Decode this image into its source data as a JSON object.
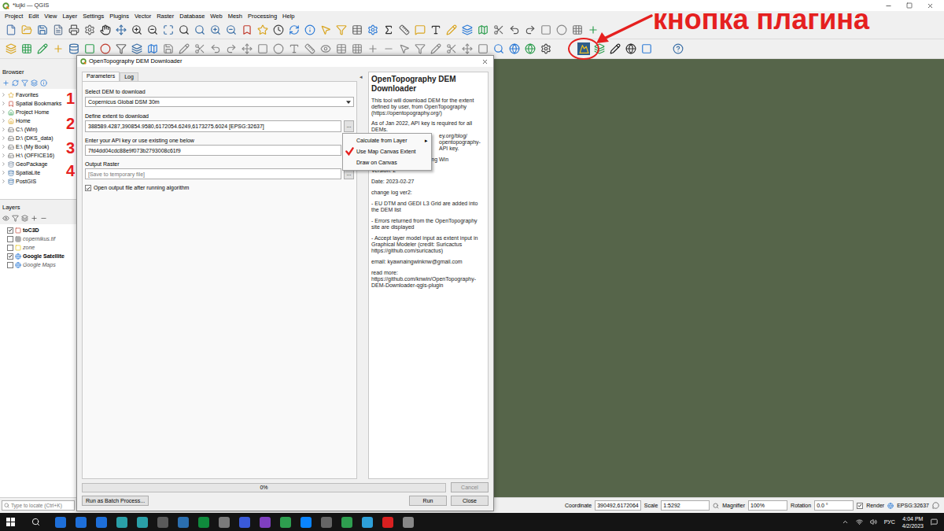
{
  "window": {
    "title": "*lujki — QGIS"
  },
  "menu": [
    "Project",
    "Edit",
    "View",
    "Layer",
    "Settings",
    "Plugins",
    "Vector",
    "Raster",
    "Database",
    "Web",
    "Mesh",
    "Processing",
    "Help"
  ],
  "annotation": {
    "label": "кнопка плагина",
    "steps": [
      "1",
      "2",
      "3",
      "4"
    ]
  },
  "browser": {
    "title": "Browser",
    "items": [
      {
        "label": "Favorites"
      },
      {
        "label": "Spatial Bookmarks"
      },
      {
        "label": "Project Home"
      },
      {
        "label": "Home"
      },
      {
        "label": "C:\\ (Win)"
      },
      {
        "label": "D:\\ (DKS_data)"
      },
      {
        "label": "E:\\ (My Book)"
      },
      {
        "label": "H:\\ (OFFICE16)"
      },
      {
        "label": "GeoPackage"
      },
      {
        "label": "SpatiaLite"
      },
      {
        "label": "PostGIS"
      }
    ]
  },
  "layers": {
    "title": "Layers",
    "items": [
      {
        "label": "toC3D",
        "checked": true
      },
      {
        "label": "copernikus.tif",
        "checked": false
      },
      {
        "label": "zone",
        "checked": false
      },
      {
        "label": "Google Satellite",
        "checked": true
      },
      {
        "label": "Google Maps",
        "checked": false
      }
    ]
  },
  "dialog": {
    "title": "OpenTopography DEM Downloader",
    "tabs": [
      {
        "label": "Parameters",
        "selected": true
      },
      {
        "label": "Log",
        "selected": false
      }
    ],
    "params": {
      "dem_label": "Select DEM to download",
      "dem_value": "Copernicus Global DSM 30m",
      "extent_label": "Define extent to download",
      "extent_value": "388589.4287,390854.9580,6172054.6249,6173275.6024 [EPSG:32637]",
      "api_label": "Enter your API key or use existing one below",
      "api_value": "7fd4dd04cdc88e9f073b2793008c61f9",
      "output_label": "Output Raster",
      "output_placeholder": "[Save to temporary file]",
      "browse": "...",
      "open_output": {
        "label": "Open output file after running algorithm",
        "checked": true
      }
    },
    "extent_menu": [
      {
        "label": "Calculate from Layer",
        "submenu": "▸",
        "marked": false
      },
      {
        "label": "Use Map Canvas Extent",
        "submenu": "",
        "marked": true
      },
      {
        "label": "Draw on Canvas",
        "submenu": "",
        "marked": false
      }
    ],
    "collapse": "◂",
    "help": {
      "title": "OpenTopography DEM Downloader",
      "intro": "This tool will download DEM for the extent defined by user, from OpenTopography (https://opentopography.org/)",
      "api_note": "As of Jan 2022, API key is required for all DEMs.",
      "fragments": [
        "ey.org/blog/",
        "opentopography-",
        "API key."
      ],
      "paragraphs": [
        "Developed by: Kyaw Naing Win",
        "Version: 2",
        "Date: 2023-02-27",
        "change log ver2:",
        "- EU DTM and GEDI L3 Grid are added into the DEM list",
        "- Errors returned from the OpenTopography site are displayed",
        "- Accept layer model input as extent input in Graphical Modeler (credit: Suricactus https://github.com/suricactus)",
        "email: kyawnaingwinknw@gmail.com",
        "read more: https://github.com/knwin/OpenTopography-DEM-Downloader-qgis-plugin"
      ]
    },
    "progress": {
      "level": 0,
      "reading": "0%"
    },
    "buttons": {
      "cancel": {
        "label": "Cancel",
        "disabled": true
      },
      "batch": "Run as Batch Process...",
      "run": "Run",
      "close": "Close"
    }
  },
  "status_bar": {
    "locator_placeholder": "Type to locate (Ctrl+K)",
    "coordinate_label": "Coordinate",
    "coordinate": "390492,6172064",
    "scale_label": "Scale",
    "scale": "1:5292",
    "magnifier_label": "Magnifier",
    "magnifier": "100%",
    "rotation_label": "Rotation",
    "rotation": "0.0 °",
    "render": {
      "label": "Render",
      "checked": true
    },
    "crs": "EPSG:32637"
  },
  "taskbar": {
    "language": "РУС",
    "time": "4:04 PM",
    "date": "4/2/2023"
  }
}
